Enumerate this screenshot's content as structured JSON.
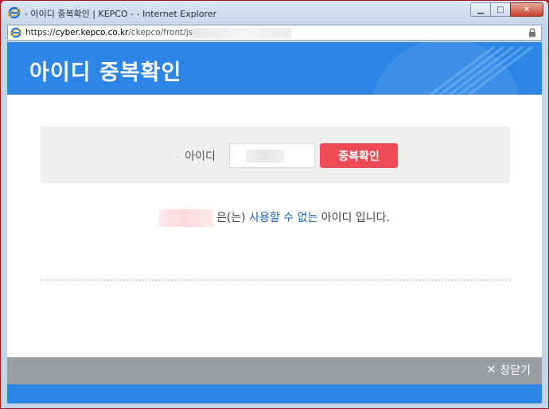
{
  "window": {
    "title": "- 아이디 중복확인 | KEPCO - - Internet Explorer",
    "minimize_label": "▁",
    "maximize_label": "□",
    "close_label": "✕"
  },
  "address_bar": {
    "scheme": "https://",
    "host": "cyber.kepco.co.kr",
    "path": "/ckepco/front/jsp"
  },
  "header": {
    "title": "아이디 중복확인"
  },
  "search": {
    "bullet": "·",
    "label": "아이디",
    "button_label": "중복확인"
  },
  "result": {
    "suffix": "은(는)",
    "highlight": "사용할 수 없는",
    "tail": "아이디 입니다."
  },
  "footer": {
    "close_icon_glyph": "✕",
    "close_label": "창닫기"
  },
  "colors": {
    "header_blue": "#2d86e6",
    "button_red": "#ef4b56",
    "highlight_blue": "#1f67c1",
    "footer_gray": "#9a9da2"
  }
}
